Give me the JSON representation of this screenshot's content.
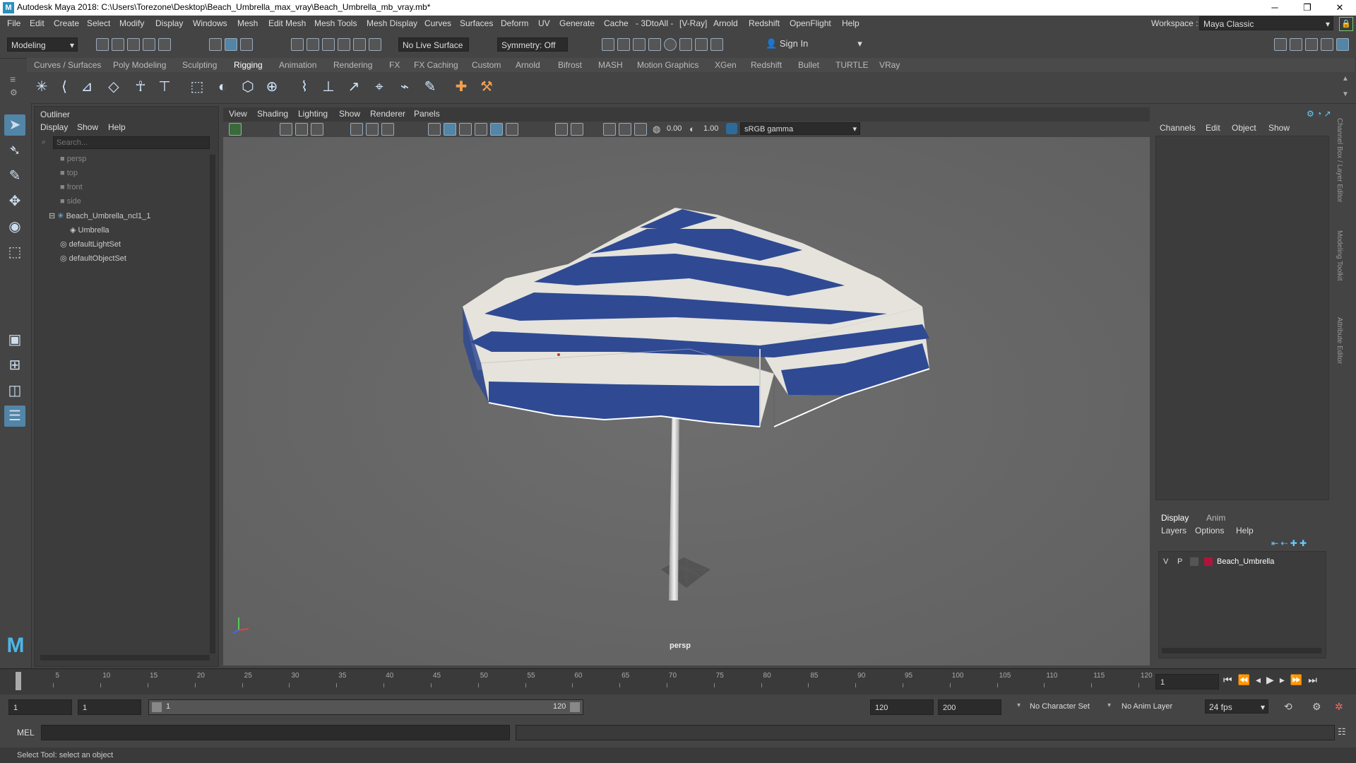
{
  "window": {
    "title": "Autodesk Maya 2018: C:\\Users\\Torezone\\Desktop\\Beach_Umbrella_max_vray\\Beach_Umbrella_mb_vray.mb*",
    "app_icon": "M",
    "controls": {
      "minimize": "─",
      "maximize": "❐",
      "close": "✕"
    }
  },
  "menubar": {
    "items": [
      "File",
      "Edit",
      "Create",
      "Select",
      "Modify",
      "Display",
      "Windows",
      "Mesh",
      "Edit Mesh",
      "Mesh Tools",
      "Mesh Display",
      "Curves",
      "Surfaces",
      "Deform",
      "UV",
      "Generate",
      "Cache",
      "- 3DtoAll -",
      "[V-Ray]",
      "Arnold",
      "Redshift",
      "OpenFlight",
      "Help"
    ],
    "workspace_label": "Workspace :",
    "workspace_value": "Maya Classic"
  },
  "toolbar": {
    "mode": "Modeling",
    "live_surface": "No Live Surface",
    "symmetry": "Symmetry: Off",
    "sign_in": "Sign In"
  },
  "shelf": {
    "tabs": [
      "Curves / Surfaces",
      "Poly Modeling",
      "Sculpting",
      "Rigging",
      "Animation",
      "Rendering",
      "FX",
      "FX Caching",
      "Custom",
      "Arnold",
      "Bifrost",
      "MASH",
      "Motion Graphics",
      "XGen",
      "Redshift",
      "Bullet",
      "TURTLE",
      "VRay"
    ],
    "active_tab": "Rigging"
  },
  "outliner": {
    "title": "Outliner",
    "menu": [
      "Display",
      "Show",
      "Help"
    ],
    "search_placeholder": "Search...",
    "items": [
      {
        "label": "persp",
        "style": "dim",
        "icon": "camera-icon"
      },
      {
        "label": "top",
        "style": "dim",
        "icon": "camera-icon"
      },
      {
        "label": "front",
        "style": "dim",
        "icon": "camera-icon"
      },
      {
        "label": "side",
        "style": "dim",
        "icon": "camera-icon"
      },
      {
        "label": "Beach_Umbrella_ncl1_1",
        "style": "normal",
        "icon": "joint-icon"
      },
      {
        "label": "Umbrella",
        "style": "normal",
        "icon": "mesh-icon"
      },
      {
        "label": "defaultLightSet",
        "style": "normal",
        "icon": "set-icon"
      },
      {
        "label": "defaultObjectSet",
        "style": "normal",
        "icon": "set-icon"
      }
    ]
  },
  "viewport": {
    "menu": [
      "View",
      "Shading",
      "Lighting",
      "Show",
      "Renderer",
      "Panels"
    ],
    "exposure": "0.00",
    "gamma": "1.00",
    "color_space": "sRGB gamma",
    "camera_label": "persp"
  },
  "channel_box": {
    "menu": [
      "Channels",
      "Edit",
      "Object",
      "Show"
    ],
    "side_tabs": [
      "Channel Box / Layer Editor",
      "Modeling Toolkit",
      "Attribute Editor"
    ]
  },
  "layer_editor": {
    "tabs": [
      "Display",
      "Anim"
    ],
    "menu": [
      "Layers",
      "Options",
      "Help"
    ],
    "layer": {
      "v": "V",
      "p": "P",
      "name": "Beach_Umbrella",
      "color": "#b0143c"
    }
  },
  "timeline": {
    "ticks": [
      "1",
      "5",
      "10",
      "15",
      "20",
      "25",
      "30",
      "35",
      "40",
      "45",
      "50",
      "55",
      "60",
      "65",
      "70",
      "75",
      "80",
      "85",
      "90",
      "95",
      "100",
      "105",
      "110",
      "115",
      "120"
    ],
    "current_frame": "1"
  },
  "range": {
    "start": "1",
    "playback_start": "1",
    "slider_start": "1",
    "slider_end": "120",
    "playback_end": "120",
    "end": "200",
    "character_set": "No Character Set",
    "anim_layer": "No Anim Layer",
    "fps": "24 fps"
  },
  "mel": {
    "label": "MEL"
  },
  "status": {
    "text": "Select Tool: select an object"
  },
  "colors": {
    "accent": "#5285a6",
    "umbrella_blue": "#2f4a93",
    "umbrella_white": "#e5e3dc"
  }
}
